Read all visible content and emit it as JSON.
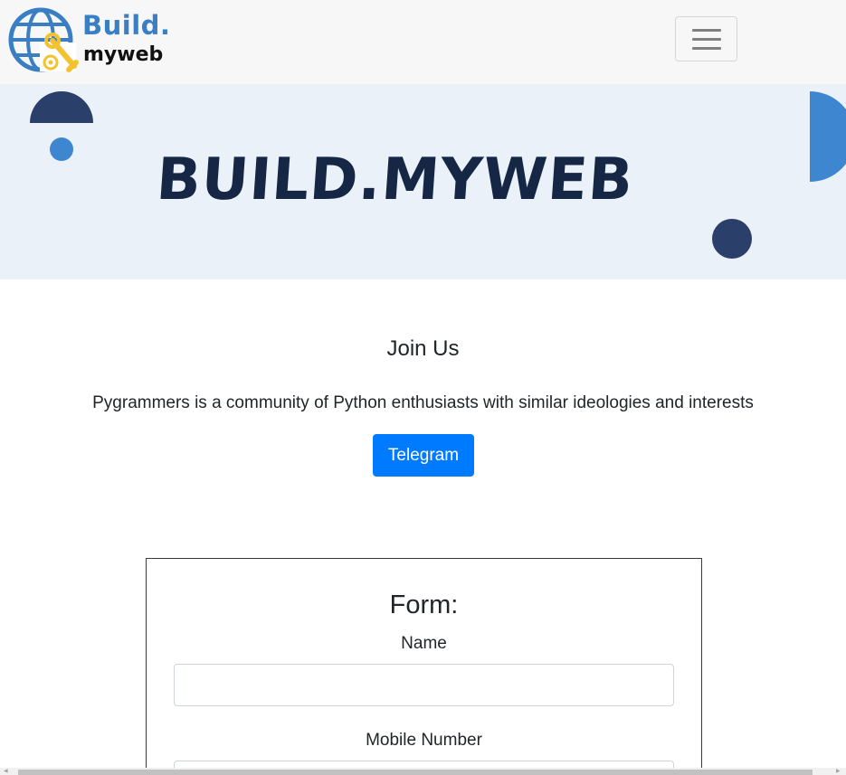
{
  "brand": {
    "name_top": "Build.",
    "name_bottom": "myweb",
    "icon": "globe-wrench-gear-icon",
    "colors": {
      "primary": "#3a7fc4",
      "accent": "#f2c230",
      "dark": "#111111"
    }
  },
  "navbar": {
    "toggler_icon": "hamburger-menu-icon"
  },
  "hero": {
    "title": "BUILD.MYWEB",
    "colors": {
      "background": "#eaf1f9",
      "title": "#152744",
      "dark_shape": "#2b3f6b",
      "light_shape": "#3f86d0"
    }
  },
  "join": {
    "title": "Join Us",
    "description": "Pygrammers is a community of Python enthusiasts with similar ideologies and interests",
    "button_label": "Telegram",
    "button_color": "#007bff"
  },
  "form": {
    "title": "Form:",
    "fields": [
      {
        "label": "Name",
        "value": "",
        "placeholder": ""
      },
      {
        "label": "Mobile Number",
        "value": "",
        "placeholder": ""
      }
    ]
  }
}
